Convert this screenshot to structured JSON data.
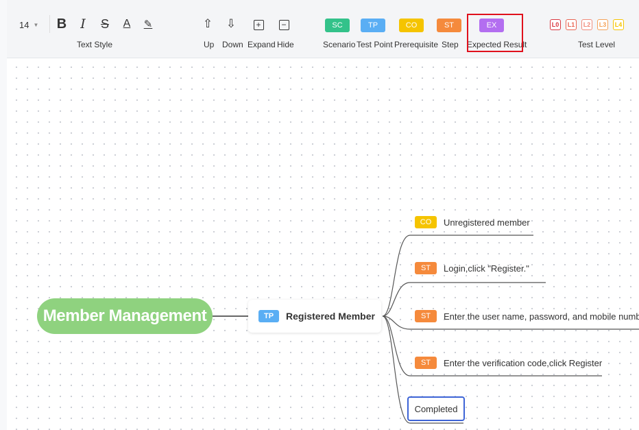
{
  "toolbar": {
    "font_size": "14",
    "text_style_label": "Text Style",
    "nav": {
      "up_label": "Up",
      "down_label": "Down",
      "expand_label": "Expand",
      "hide_label": "Hide"
    },
    "tags": {
      "sc": {
        "text": "SC",
        "label": "Scenario",
        "color": "#33c28a"
      },
      "tp": {
        "text": "TP",
        "label": "Test Point",
        "color": "#5aaef4"
      },
      "co": {
        "text": "CO",
        "label": "Prerequisite",
        "color": "#f5c400"
      },
      "st": {
        "text": "ST",
        "label": "Step",
        "color": "#f58a3c"
      },
      "ex": {
        "text": "EX",
        "label": "Expected Result",
        "color": "#b36ef0"
      }
    },
    "levels": {
      "label": "Test Level",
      "items": [
        {
          "text": "L0",
          "color": "#d9363e"
        },
        {
          "text": "L1",
          "color": "#e86452"
        },
        {
          "text": "L2",
          "color": "#f08a7a"
        },
        {
          "text": "L3",
          "color": "#f4a259"
        },
        {
          "text": "L4",
          "color": "#f5c400"
        }
      ]
    }
  },
  "mindmap": {
    "root": "Member Management",
    "test_point": {
      "tag": "TP",
      "text": "Registered Member"
    },
    "children": [
      {
        "tag": "CO",
        "text": "Unregistered member"
      },
      {
        "tag": "ST",
        "text": "Login,click \"Register.\""
      },
      {
        "tag": "ST",
        "text": "Enter the user name, password, and mobile number"
      },
      {
        "tag": "ST",
        "text": "Enter the verification code,click Register"
      },
      {
        "tag": "",
        "text": "Completed"
      }
    ]
  }
}
